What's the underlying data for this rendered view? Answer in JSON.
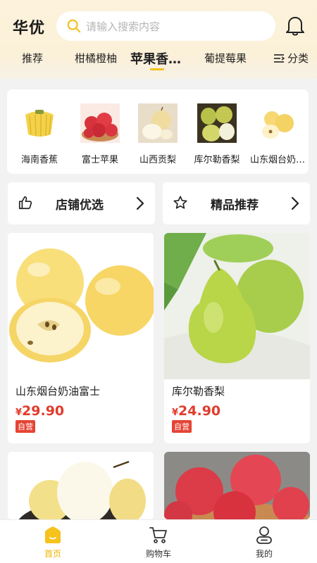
{
  "app": {
    "brand": "华优"
  },
  "search": {
    "placeholder": "请输入搜索内容"
  },
  "tabs": [
    {
      "label": "推荐"
    },
    {
      "label": "柑橘橙柚"
    },
    {
      "label": "苹果香…",
      "active": true
    },
    {
      "label": "葡提莓果"
    }
  ],
  "category_button": {
    "label": "分类"
  },
  "categories": [
    {
      "label": "海南香蕉",
      "icon": "banana-image"
    },
    {
      "label": "富士苹果",
      "icon": "apple-basket-image"
    },
    {
      "label": "山西贡梨",
      "icon": "pear-image"
    },
    {
      "label": "库尔勒香梨",
      "icon": "korla-pear-image"
    },
    {
      "label": "山东烟台奶…",
      "icon": "yantai-apple-image"
    }
  ],
  "features": [
    {
      "label": "店铺优选",
      "icon": "thumbs-up-icon"
    },
    {
      "label": "精品推荐",
      "icon": "star-icon"
    }
  ],
  "products": [
    {
      "name": "山东烟台奶油富士",
      "currency": "¥",
      "price": "29.90",
      "tag": "自营"
    },
    {
      "name": "库尔勒香梨",
      "currency": "¥",
      "price": "24.90",
      "tag": "自营"
    }
  ],
  "nav": [
    {
      "label": "首页",
      "icon": "home-icon",
      "active": true
    },
    {
      "label": "购物车",
      "icon": "cart-icon"
    },
    {
      "label": "我的",
      "icon": "user-icon"
    }
  ],
  "colors": {
    "accent": "#f3c11c",
    "price": "#e03c2d",
    "tag": "#e54434"
  }
}
